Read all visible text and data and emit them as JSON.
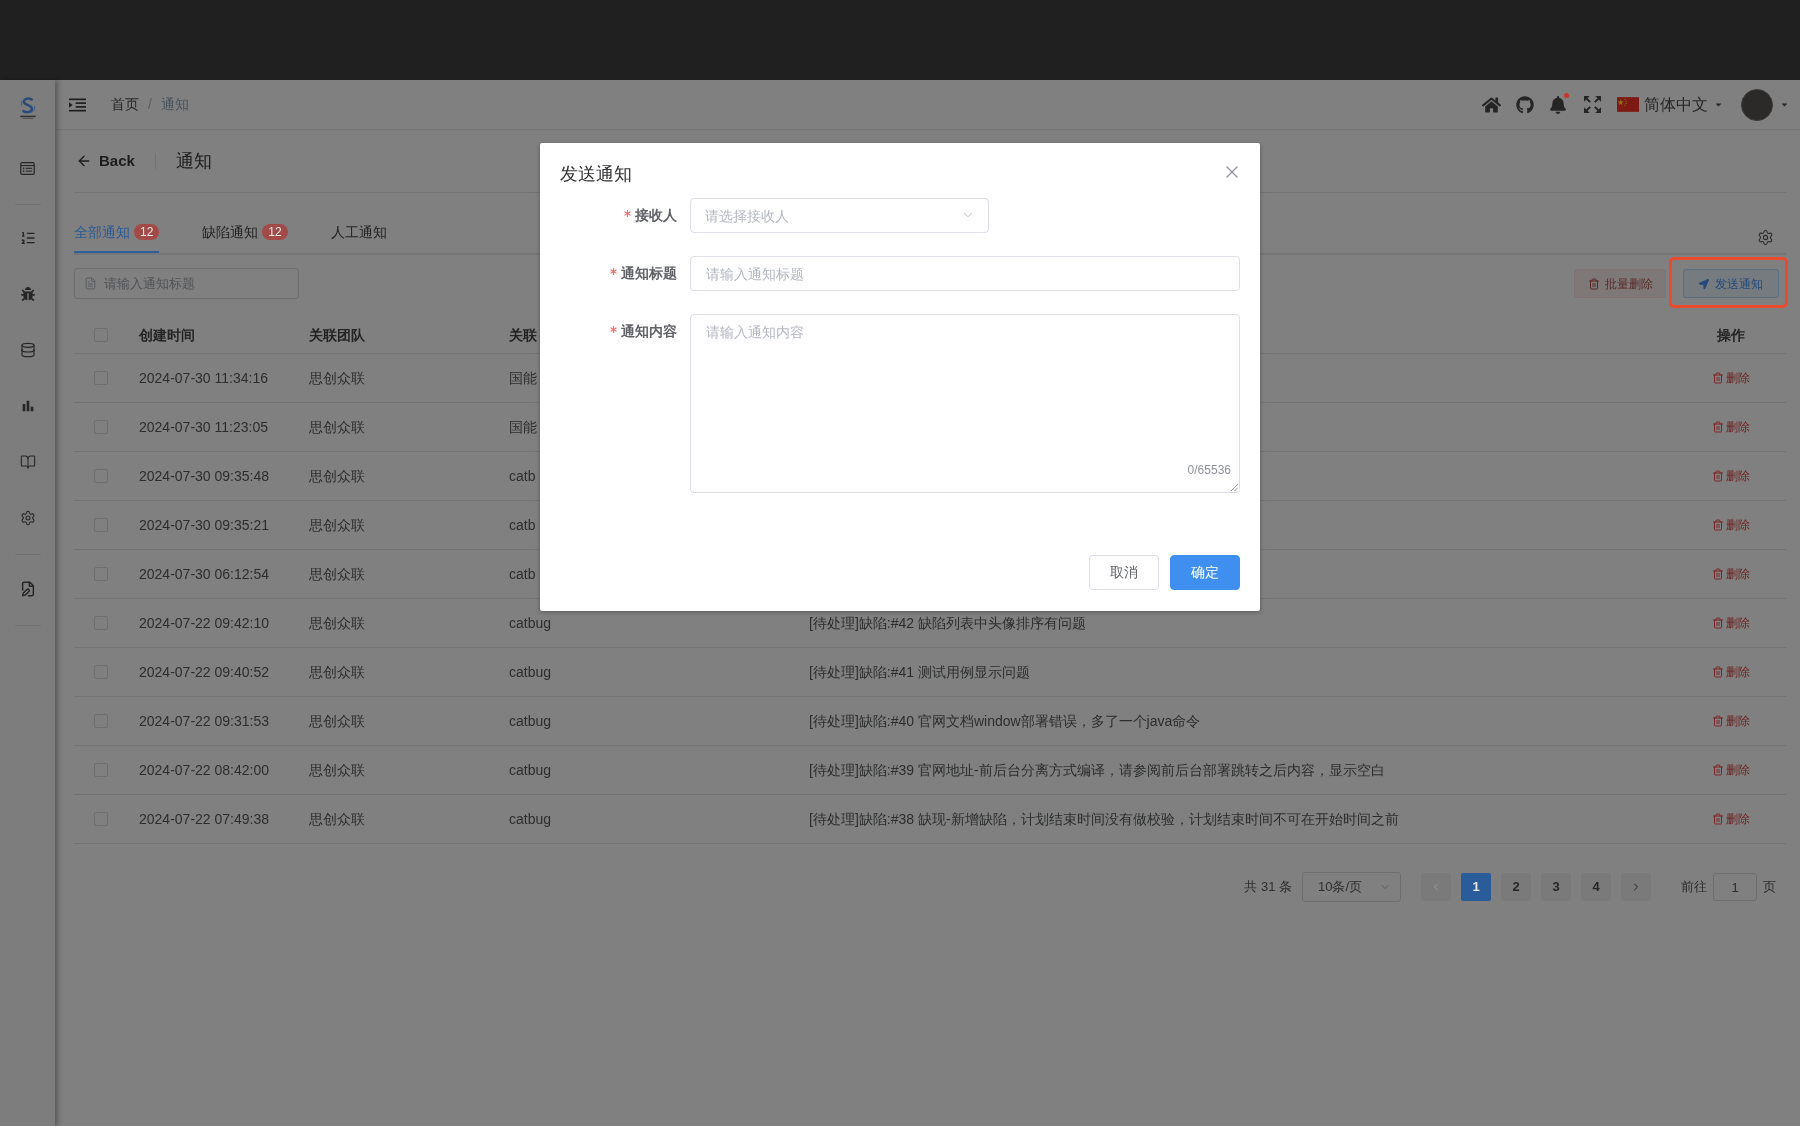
{
  "header": {
    "breadcrumb": [
      {
        "label": "首页",
        "current": false
      },
      {
        "label": "通知",
        "current": true
      }
    ],
    "separator": "/",
    "bell": {
      "unread": true
    },
    "language": "简体中文"
  },
  "page": {
    "back": "Back",
    "title": "通知"
  },
  "tabs": [
    {
      "label": "全部通知",
      "badge": "12",
      "selected": true
    },
    {
      "label": "缺陷通知",
      "badge": "12",
      "selected": false
    },
    {
      "label": "人工通知",
      "selected": false
    }
  ],
  "search": {
    "placeholder": "请输入通知标题"
  },
  "toolbar": {
    "batch_delete": {
      "label": "批量删除",
      "disabled": true
    },
    "send": {
      "label": "发送通知",
      "highlighted": true
    }
  },
  "table": {
    "header_checkbox": {
      "checked": false
    },
    "columns": [
      {
        "kind": "time",
        "label": "创建时间"
      },
      {
        "kind": "team",
        "label": "关联团队"
      },
      {
        "kind": "project",
        "label": "关联"
      },
      {
        "kind": "action",
        "label": "操作"
      }
    ],
    "rows": [
      {
        "checked": false,
        "created": "2024-07-30 11:34:16",
        "team": "思创众联",
        "project": "国能",
        "action": "删除"
      },
      {
        "checked": false,
        "created": "2024-07-30 11:23:05",
        "team": "思创众联",
        "project": "国能",
        "action": "删除"
      },
      {
        "checked": false,
        "created": "2024-07-30 09:35:48",
        "team": "思创众联",
        "project": "catb",
        "action": "删除"
      },
      {
        "checked": false,
        "created": "2024-07-30 09:35:21",
        "team": "思创众联",
        "project": "catb",
        "action": "删除"
      },
      {
        "checked": false,
        "created": "2024-07-30 06:12:54",
        "team": "思创众联",
        "project": "catb",
        "action": "删除"
      },
      {
        "checked": false,
        "created": "2024-07-22 09:42:10",
        "team": "思创众联",
        "project": "catbug",
        "title": "[待处理]缺陷:#42 缺陷列表中头像排序有问题",
        "action": "删除"
      },
      {
        "checked": false,
        "created": "2024-07-22 09:40:52",
        "team": "思创众联",
        "project": "catbug",
        "title": "[待处理]缺陷:#41 测试用例显示问题",
        "action": "删除"
      },
      {
        "checked": false,
        "created": "2024-07-22 09:31:53",
        "team": "思创众联",
        "project": "catbug",
        "title": "[待处理]缺陷:#40 官网文档window部署错误，多了一个java命令",
        "action": "删除"
      },
      {
        "checked": false,
        "created": "2024-07-22 08:42:00",
        "team": "思创众联",
        "project": "catbug",
        "title": "[待处理]缺陷:#39 官网地址-前后台分离方式编译，请参阅前后台部署跳转之后内容，显示空白",
        "action": "删除"
      },
      {
        "checked": false,
        "created": "2024-07-22 07:49:38",
        "team": "思创众联",
        "project": "catbug",
        "title": "[待处理]缺陷:#38 缺现-新增缺陷，计划结束时间没有做校验，计划结束时间不可在开始时间之前",
        "action": "删除"
      }
    ]
  },
  "pagination": {
    "total": "共 31 条",
    "page_size": "10条/页",
    "prev": {
      "disabled": true
    },
    "pages": [
      {
        "label": "1",
        "selected": true
      },
      {
        "label": "2",
        "selected": false
      },
      {
        "label": "3",
        "selected": false
      },
      {
        "label": "4",
        "selected": false
      }
    ],
    "next": {
      "disabled": false
    },
    "goto_label": "前往",
    "goto_value": "1",
    "goto_suffix": "页"
  },
  "modal": {
    "title": "发送通知",
    "fields": [
      {
        "kind": "select",
        "label": "接收人",
        "required": true,
        "placeholder": "请选择接收人"
      },
      {
        "kind": "input",
        "label": "通知标题",
        "required": true,
        "placeholder": "请输入通知标题"
      },
      {
        "kind": "textarea",
        "label": "通知内容",
        "required": true,
        "placeholder": "请输入通知内容",
        "counter": "0/65536"
      }
    ],
    "buttons": [
      {
        "kind": "default",
        "label": "取消"
      },
      {
        "kind": "primary",
        "label": "确定"
      }
    ]
  }
}
